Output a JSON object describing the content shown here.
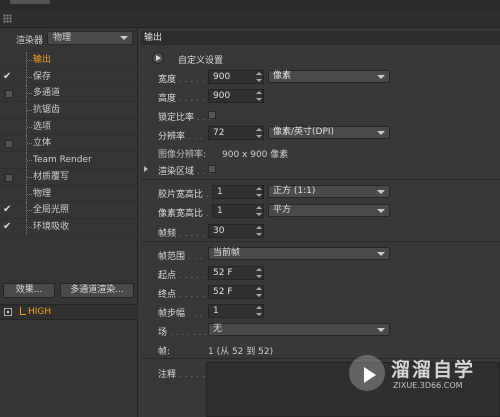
{
  "sidebar": {
    "renderer_label": "渲染器",
    "renderer_value": "物理",
    "items": [
      {
        "label": "输出",
        "check": "none",
        "active": true
      },
      {
        "label": "保存",
        "check": "checked",
        "active": false
      },
      {
        "label": "多通道",
        "check": "box",
        "active": false
      },
      {
        "label": "抗锯齿",
        "check": "none",
        "active": false
      },
      {
        "label": "选项",
        "check": "none",
        "active": false
      },
      {
        "label": "立体",
        "check": "box",
        "active": false
      },
      {
        "label": "Team Render",
        "check": "none",
        "active": false
      },
      {
        "label": "材质覆写",
        "check": "box",
        "active": false
      },
      {
        "label": "物理",
        "check": "none",
        "active": false
      },
      {
        "label": "全局光照",
        "check": "checked",
        "active": false
      },
      {
        "label": "环境吸收",
        "check": "checked",
        "active": false
      }
    ],
    "effects_button": "效果...",
    "multipass_button": "多通道渲染...",
    "preset_name": "HIGH"
  },
  "output": {
    "section_title": "输出",
    "preset": "自定义设置",
    "width_label": "宽度",
    "width_value": "900",
    "width_unit": "像素",
    "height_label": "高度",
    "height_value": "900",
    "lock_ratio_label": "锁定比率",
    "resolution_label": "分辨率",
    "resolution_value": "72",
    "resolution_unit": "像素/英寸(DPI)",
    "image_res_label": "图像分辨率:",
    "image_res_value": "900 x 900 像素",
    "render_region_label": "渲染区域",
    "film_aspect_label": "胶片宽高比",
    "film_aspect_value": "1",
    "film_aspect_preset": "正方 (1:1)",
    "pixel_aspect_label": "像素宽高比",
    "pixel_aspect_value": "1",
    "pixel_aspect_preset": "平方",
    "fps_label": "帧频",
    "fps_value": "30",
    "frame_range_label": "帧范围",
    "frame_range_value": "当前帧",
    "start_label": "起点",
    "start_value": "52 F",
    "end_label": "终点",
    "end_value": "52 F",
    "frame_step_label": "帧步幅",
    "frame_step_value": "1",
    "fields_label": "场",
    "fields_value": "无",
    "frames_label": "帧:",
    "frames_value": "1 (从 52 到 52)",
    "notes_label": "注释"
  },
  "watermark": {
    "title": "溜溜自学",
    "url": "ZIXUE.3D66.COM"
  }
}
